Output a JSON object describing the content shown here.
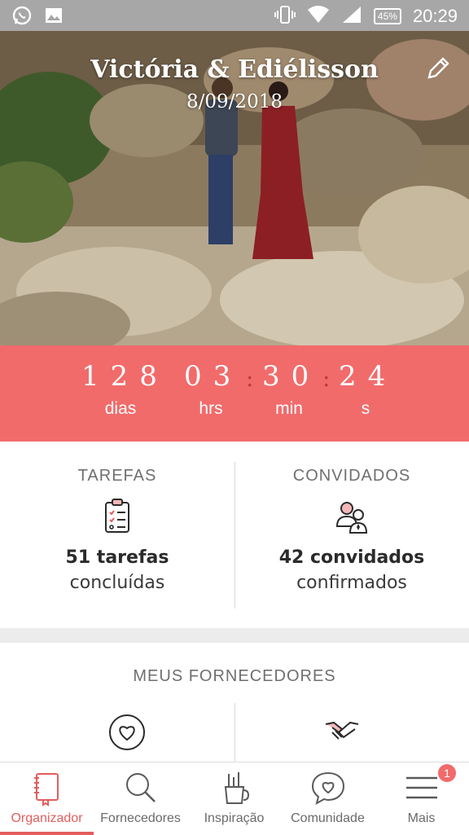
{
  "status_bar": {
    "battery": "45%",
    "time": "20:29",
    "icons": [
      "whatsapp-icon",
      "gallery-icon",
      "vibrate-icon",
      "wifi-icon",
      "signal-icon",
      "battery-icon"
    ]
  },
  "hero": {
    "couple_names": "Victória & Ediélisson",
    "wedding_date": "8/09/2018",
    "edit_icon": "pencil-icon"
  },
  "countdown": {
    "days": {
      "value": "128",
      "label": "dias"
    },
    "hours": {
      "value": "03",
      "label": "hrs"
    },
    "minutes": {
      "value": "30",
      "label": "min"
    },
    "seconds": {
      "value": "24",
      "label": "s"
    },
    "separator": ":"
  },
  "stats": {
    "tasks": {
      "heading": "TAREFAS",
      "count_text": "51 tarefas",
      "sub_text": "concluídas",
      "icon": "checklist-icon"
    },
    "guests": {
      "heading": "CONVIDADOS",
      "count_text": "42 convidados",
      "sub_text": "confirmados",
      "icon": "guests-icon"
    }
  },
  "vendors": {
    "heading": "MEUS FORNECEDORES",
    "icons": [
      "heart-circle-icon",
      "handshake-icon"
    ]
  },
  "bottom_nav": {
    "items": [
      {
        "label": "Organizador",
        "icon": "notebook-icon",
        "active": true
      },
      {
        "label": "Fornecedores",
        "icon": "search-icon",
        "active": false
      },
      {
        "label": "Inspiração",
        "icon": "brush-cup-icon",
        "active": false
      },
      {
        "label": "Comunidade",
        "icon": "chat-heart-icon",
        "active": false
      },
      {
        "label": "Mais",
        "icon": "menu-icon",
        "active": false,
        "badge": "1"
      }
    ]
  },
  "colors": {
    "accent": "#f16b6b",
    "nav_active": "#e35d5d",
    "status_bar": "#a7a7a7"
  }
}
